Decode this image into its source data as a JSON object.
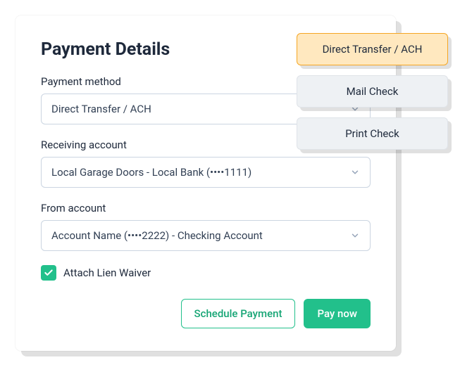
{
  "title": "Payment Details",
  "fields": {
    "payment_method": {
      "label": "Payment method",
      "value": "Direct Transfer / ACH"
    },
    "receiving_account": {
      "label": "Receiving account",
      "value": "Local Garage Doors - Local Bank (••••1111)"
    },
    "from_account": {
      "label": "From account",
      "value": "Account Name (••••2222) - Checking Account"
    }
  },
  "checkbox": {
    "label": "Attach Lien Waiver",
    "checked": true
  },
  "buttons": {
    "schedule": "Schedule Payment",
    "pay_now": "Pay now"
  },
  "menu": {
    "items": [
      {
        "label": "Direct Transfer / ACH",
        "active": true
      },
      {
        "label": "Mail Check",
        "active": false
      },
      {
        "label": "Print Check",
        "active": false
      }
    ]
  },
  "colors": {
    "accent": "#22c08b",
    "highlight_bg": "#ffe8bf",
    "highlight_border": "#f5a623"
  }
}
